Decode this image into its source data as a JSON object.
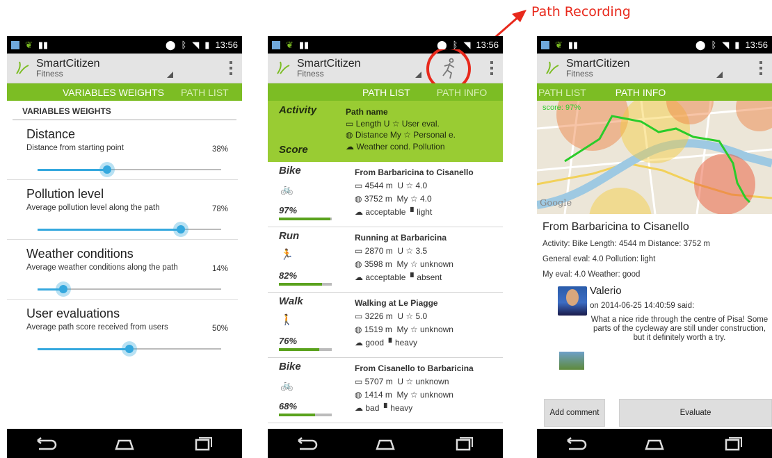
{
  "annotation": {
    "label": "Path Recording"
  },
  "status": {
    "time": "13:56"
  },
  "app": {
    "title": "SmartCitizen",
    "subtitle": "Fitness"
  },
  "screen1": {
    "tabs": [
      "VARIABLES WEIGHTS",
      "PATH LIST"
    ],
    "section_header": "VARIABLES WEIGHTS",
    "weights": [
      {
        "title": "Distance",
        "desc": "Distance from starting point",
        "pct_label": "38%",
        "value": 0.38
      },
      {
        "title": "Pollution level",
        "desc": "Average pollution level along the path",
        "pct_label": "78%",
        "value": 0.78
      },
      {
        "title": "Weather conditions",
        "desc": "Average weather conditions along the path",
        "pct_label": "14%",
        "value": 0.14
      },
      {
        "title": "User evaluations",
        "desc": "Average path score received from users",
        "pct_label": "50%",
        "value": 0.5
      }
    ]
  },
  "screen2": {
    "tabs": [
      "PATH LIST",
      "PATH INFO"
    ],
    "header": {
      "activity": "Activity",
      "score": "Score",
      "path_name": "Path name",
      "line1": "Length  U ☆ User eval.",
      "line2": "Distance  My ☆ Personal e.",
      "line3": "Weather cond.  Pollution"
    },
    "paths": [
      {
        "activity": "Bike",
        "score": "97%",
        "score_value": 0.97,
        "name": "From Barbaricina to Cisanello",
        "length": "4544 m",
        "user_eval": "U ☆ 4.0",
        "distance": "3752 m",
        "my_eval": "My ☆ 4.0",
        "weather": "acceptable",
        "pollution": "light"
      },
      {
        "activity": "Run",
        "score": "82%",
        "score_value": 0.82,
        "name": "Running at Barbaricina",
        "length": "2870 m",
        "user_eval": "U ☆ 3.5",
        "distance": "3598 m",
        "my_eval": "My ☆ unknown",
        "weather": "acceptable",
        "pollution": "absent"
      },
      {
        "activity": "Walk",
        "score": "76%",
        "score_value": 0.76,
        "name": "Walking at Le Piagge",
        "length": "3226 m",
        "user_eval": "U ☆ 5.0",
        "distance": "1519 m",
        "my_eval": "My ☆ unknown",
        "weather": "good",
        "pollution": "heavy"
      },
      {
        "activity": "Bike",
        "score": "68%",
        "score_value": 0.68,
        "name": "From Cisanello to Barbaricina",
        "length": "5707 m",
        "user_eval": "U ☆ unknown",
        "distance": "1414 m",
        "my_eval": "My ☆ unknown",
        "weather": "bad",
        "pollution": "heavy"
      }
    ]
  },
  "screen3": {
    "tabs": [
      "PATH LIST",
      "PATH INFO"
    ],
    "map_score": "score: 97%",
    "map_brand": "Google",
    "title": "From Barbaricina to Cisanello",
    "line1": "Activity: Bike Length: 4544 m Distance: 3752 m",
    "line2": "General eval: 4.0 Pollution: light",
    "line3": "My eval: 4.0 Weather: good",
    "comment": {
      "user": "Valerio",
      "date": "on 2014-06-25 14:40:59 said:",
      "text": "What a nice ride through the centre of Pisa! Some parts of the cycleway are still under construction, but it definitely worth a try."
    },
    "buttons": {
      "add_comment": "Add comment",
      "evaluate": "Evaluate"
    }
  }
}
